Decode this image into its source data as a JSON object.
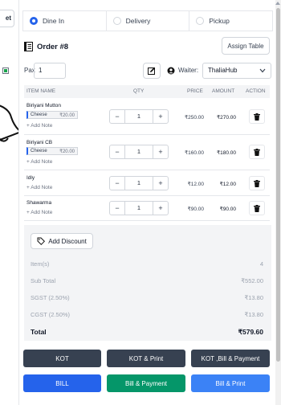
{
  "left_panel": {
    "button_label": "et"
  },
  "order_types": [
    {
      "label": "Dine In",
      "selected": true
    },
    {
      "label": "Delivery",
      "selected": false
    },
    {
      "label": "Pickup",
      "selected": false
    }
  ],
  "order": {
    "title": "Order #8",
    "assign_table_label": "Assign Table"
  },
  "pax": {
    "label": "Pax",
    "value": "1"
  },
  "waiter": {
    "label": "Waiter:",
    "value": "ThaliaHub"
  },
  "table": {
    "headers": {
      "item_name": "ITEM NAME",
      "qty": "QTY",
      "price": "PRICE",
      "amount": "AMOUNT",
      "action": "ACTION"
    },
    "rows": [
      {
        "name": "Biriyani Mutton",
        "addon": {
          "name": "Cheese",
          "price": "₹20.00"
        },
        "note": "+ Add Note",
        "qty": "1",
        "price": "₹250.00",
        "amount": "₹270.00"
      },
      {
        "name": "Biriyani CB",
        "addon": {
          "name": "Cheese",
          "price": "₹20.00"
        },
        "note": "+ Add Note",
        "qty": "1",
        "price": "₹160.00",
        "amount": "₹180.00"
      },
      {
        "name": "Idly",
        "note": "+ Add Note",
        "qty": "1",
        "price": "₹12.00",
        "amount": "₹12.00"
      },
      {
        "name": "Shawarma",
        "note": "+ Add Note",
        "qty": "1",
        "price": "₹90.00",
        "amount": "₹90.00"
      }
    ]
  },
  "summary": {
    "discount_label": "Add Discount",
    "items_label": "Item(s)",
    "items_value": "4",
    "subtotal_label": "Sub Total",
    "subtotal_value": "₹552.00",
    "sgst_label": "SGST (2.50%)",
    "sgst_value": "₹13.80",
    "cgst_label": "CGST (2.50%)",
    "cgst_value": "₹13.80",
    "total_label": "Total",
    "total_value": "₹579.60"
  },
  "actions": {
    "kot": "KOT",
    "kot_print": "KOT & Print",
    "kot_bill_payment": "KOT ,Bill & Payment",
    "bill": "BILL",
    "bill_payment": "Bill & Payment",
    "bill_print": "Bill & Print"
  },
  "colors": {
    "dark_button": "#374151",
    "blue_button": "#2563eb",
    "green_button": "#059669",
    "light_blue_button": "#3b82f6",
    "accent": "#2563eb"
  }
}
